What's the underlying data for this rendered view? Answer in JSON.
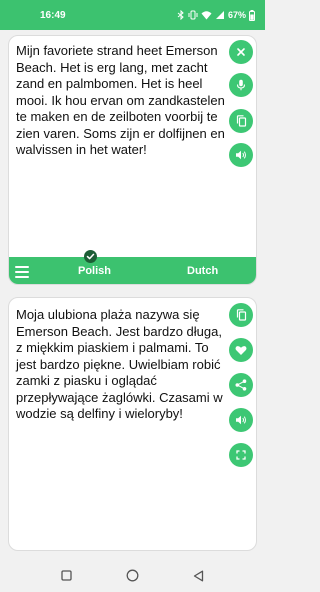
{
  "status_bar": {
    "time": "16:49",
    "battery": "67%",
    "icons": [
      "bluetooth-icon",
      "vibrate-icon",
      "wifi-icon",
      "signal-icon",
      "battery-icon"
    ]
  },
  "source_panel": {
    "text": "Mijn favoriete strand heet Emerson Beach. Het is erg lang, met zacht zand en palmbomen. Het is heel mooi. Ik hou ervan om zandkastelen te maken en de zeilboten voorbij te zien varen. Soms zijn er dolfijnen en walvissen in het water!",
    "actions": [
      "close-icon",
      "microphone-icon",
      "copy-icon",
      "speaker-icon"
    ]
  },
  "language_bar": {
    "source_language": "Polish",
    "target_language": "Dutch",
    "menu_icon": "menu-icon",
    "selected_indicator": "check-icon"
  },
  "target_panel": {
    "text": "Moja ulubiona plaża nazywa się Emerson Beach. Jest bardzo długa, z miękkim piaskiem i palmami. To jest bardzo piękne. Uwielbiam robić zamki z piasku i oglądać przepływające żaglówki. Czasami w wodzie są delfiny i wieloryby!",
    "actions": [
      "copy-icon",
      "heart-icon",
      "share-icon",
      "speaker-icon",
      "fullscreen-icon"
    ]
  },
  "nav_bar": {
    "buttons": [
      "recents-button",
      "home-button",
      "back-button"
    ]
  },
  "colors": {
    "accent": "#3cc26f",
    "fab": "#3dc774",
    "check_badge": "#1c5e36"
  }
}
